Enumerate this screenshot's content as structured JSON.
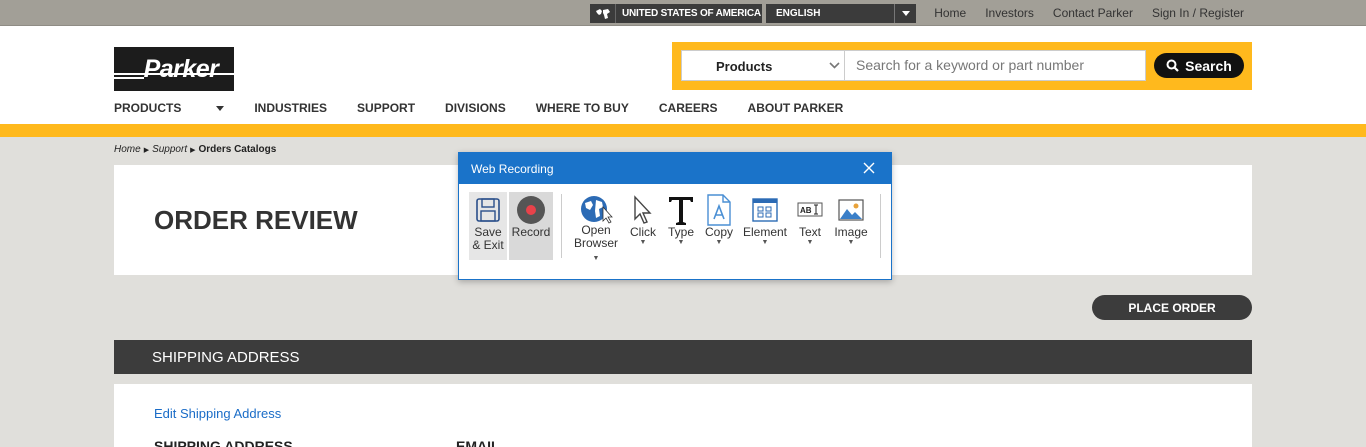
{
  "utility": {
    "country": "UNITED STATES OF AMERICA",
    "language": "ENGLISH",
    "links": [
      "Home",
      "Investors",
      "Contact Parker",
      "Sign In / Register"
    ]
  },
  "header": {
    "logo_text": "Parker",
    "search": {
      "category": "Products",
      "placeholder": "Search for a keyword or part number",
      "button_label": "Search"
    },
    "nav": [
      "PRODUCTS",
      "INDUSTRIES",
      "SUPPORT",
      "DIVISIONS",
      "WHERE TO BUY",
      "CAREERS",
      "ABOUT PARKER"
    ]
  },
  "breadcrumb": [
    "Home",
    "Support",
    "Orders Catalogs"
  ],
  "main": {
    "title": "ORDER REVIEW",
    "place_order_label": "PLACE ORDER",
    "shipping_header": "SHIPPING ADDRESS",
    "edit_shipping_link": "Edit Shipping Address",
    "col_shipping": "SHIPPING ADDRESS",
    "col_email": "EMAIL"
  },
  "dialog": {
    "title": "Web Recording",
    "tools": {
      "save": [
        "Save",
        "& Exit"
      ],
      "record": "Record",
      "open": [
        "Open",
        "Browser"
      ],
      "click": "Click",
      "type": "Type",
      "copy": "Copy",
      "element": "Element",
      "text": "Text",
      "image": "Image"
    }
  },
  "colors": {
    "accent_yellow": "#ffb91d",
    "dialog_blue": "#1a73c9",
    "dark_bar": "#3c3c3c"
  }
}
